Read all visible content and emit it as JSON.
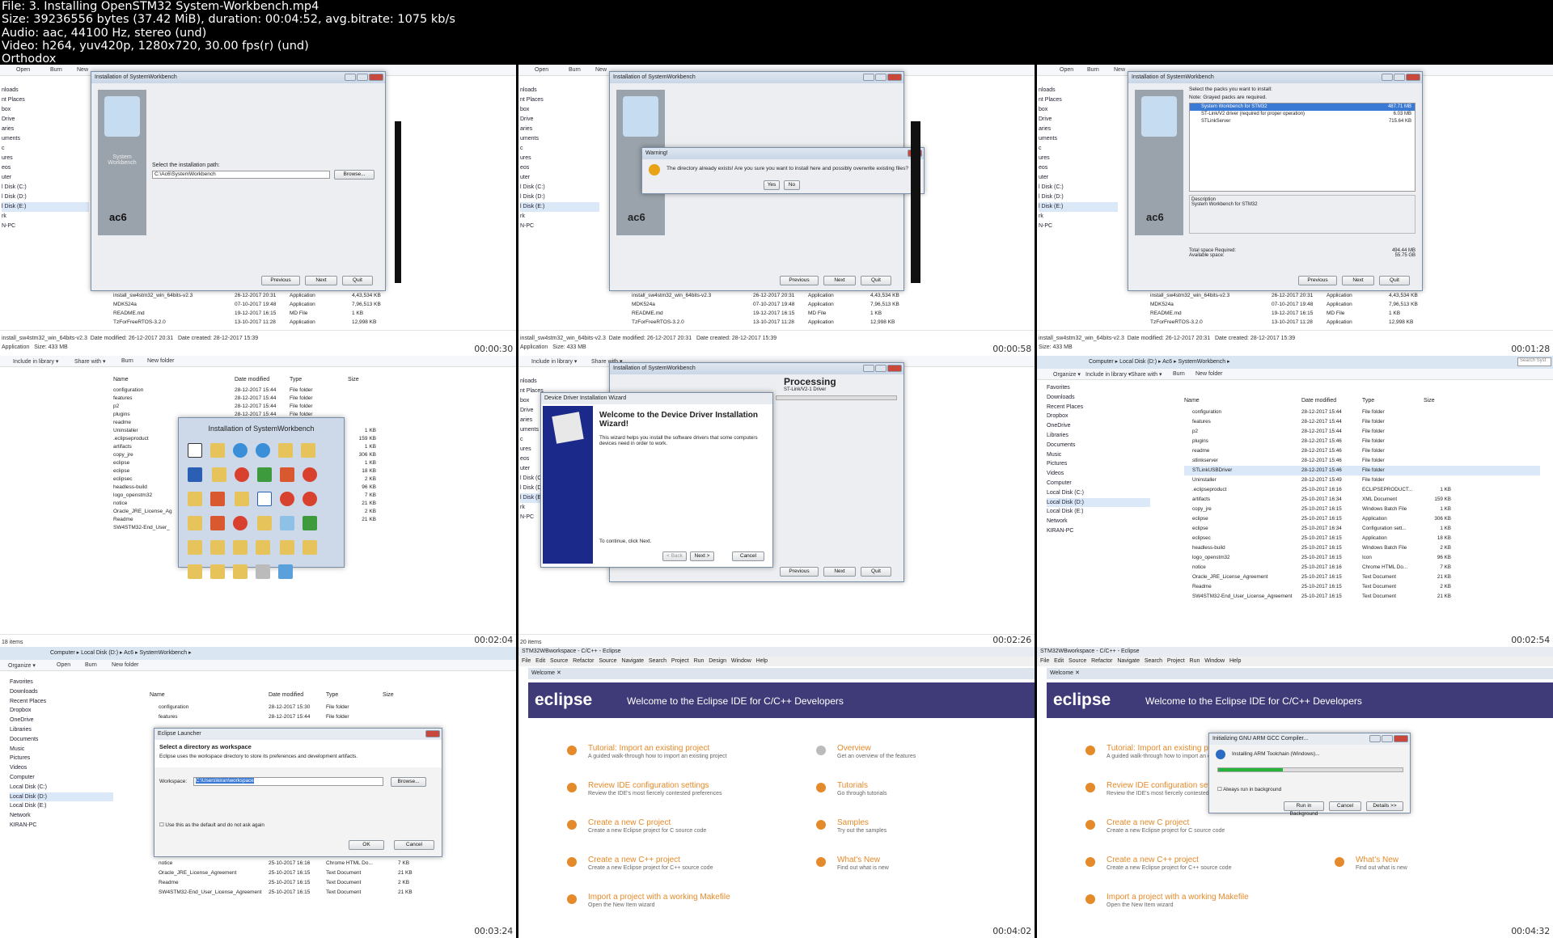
{
  "header": {
    "line1": "File: 3. Installing OpenSTM32  System-Workbench.mp4",
    "line2": "Size: 39236556 bytes (37.42 MiB), duration: 00:04:52, avg.bitrate: 1075 kb/s",
    "line3": "Audio: aac, 44100 Hz, stereo (und)",
    "line4": "Video: h264, yuv420p, 1280x720, 30.00 fps(r) (und)",
    "line5": "Orthodox"
  },
  "timestamps": [
    "00:00:30",
    "00:00:58",
    "00:01:28",
    "00:02:04",
    "00:02:26",
    "00:02:54",
    "00:03:24",
    "00:04:02",
    "00:04:32"
  ],
  "explorer": {
    "open": "Open",
    "burn": "Burn",
    "new": "New",
    "include": "Include in library ▾",
    "share": "Share with ▾",
    "newfolder": "New folder",
    "organize": "Organize ▾",
    "nav": [
      "nloads",
      "nt Places",
      "box",
      "Drive",
      "aries",
      "uments",
      "c",
      "ures",
      "eos",
      "uter",
      "l Disk (C:)",
      "l Disk (D:)",
      "l Disk (E:)",
      "rk",
      "N-PC"
    ],
    "files": [
      {
        "name": "install_sw4stm32_win_64bits-v2.3",
        "date": "26-12-2017 20:31",
        "type": "Application",
        "size": "4,43,534 KB"
      },
      {
        "name": "MDK524a",
        "date": "07-10-2017 19:48",
        "type": "Application",
        "size": "7,96,513 KB"
      },
      {
        "name": "README.md",
        "date": "19-12-2017 16:15",
        "type": "MD File",
        "size": "1 KB"
      },
      {
        "name": "TzForFreeRTOS-3.2.0",
        "date": "13-10-2017 11:28",
        "type": "Application",
        "size": "12,998 KB"
      }
    ],
    "status_name": "install_sw4stm32_win_64bits-v2.3",
    "status_modified": "Date modified: 26-12-2017 20:31",
    "status_created": "Date created: 28-12-2017 15:39",
    "status_type": "Application",
    "status_size": "Size: 433 MB",
    "col_name": "Name",
    "col_date": "Date modified",
    "col_type": "Type",
    "col_size": "Size"
  },
  "installer": {
    "title": "Installation of SystemWorkbench",
    "logo_text": "System Workbench",
    "ac6": "ac6",
    "path_label": "Select the installation path:",
    "path_value": "C:\\Ac6\\SystemWorkbench",
    "browse": "Browse...",
    "previous": "Previous",
    "next": "Next",
    "quit": "Quit"
  },
  "warning": {
    "title": "Warning!",
    "message": "The directory already exists! Are you sure you want to install here and possibly overwrite existing files?",
    "yes": "Yes",
    "no": "No"
  },
  "packs": {
    "select": "Select the packs you want to install:",
    "note": "Note: Grayed packs are required.",
    "items": [
      {
        "name": "System Workbench for STM32",
        "size": "487.71 MB"
      },
      {
        "name": "ST-Link/V2 driver (required for proper operation)",
        "size": "6.03 MB"
      },
      {
        "name": "STLinkServer",
        "size": "715.64 KB"
      }
    ],
    "desc_label": "Description",
    "desc": "System Workbench for STM32",
    "space_req": "Total space Required:",
    "space_req_val": "494.44 MB",
    "avail": "Available space:",
    "avail_val": "55.75 GB"
  },
  "folder": {
    "items": [
      {
        "name": "configuration",
        "date": "28-12-2017 15:44",
        "type": "File folder"
      },
      {
        "name": "features",
        "date": "28-12-2017 15:44",
        "type": "File folder"
      },
      {
        "name": "p2",
        "date": "28-12-2017 15:44",
        "type": "File folder"
      },
      {
        "name": "plugins",
        "date": "28-12-2017 15:44",
        "type": "File folder"
      },
      {
        "name": "readme",
        "date": "",
        "type": ""
      },
      {
        "name": "Uninstaller",
        "date": "",
        "type": ""
      },
      {
        "name": ".eclipseproduct",
        "date": "",
        "type": ""
      },
      {
        "name": "artifacts",
        "date": "",
        "type": ""
      },
      {
        "name": "copy_jre",
        "date": "",
        "type": ""
      },
      {
        "name": "eclipse",
        "date": "",
        "type": ""
      },
      {
        "name": "eclipse",
        "date": "",
        "type": ""
      },
      {
        "name": "eclipsec",
        "date": "",
        "type": ""
      },
      {
        "name": "headless-build",
        "date": "",
        "type": ""
      },
      {
        "name": "logo_openstm32",
        "date": "",
        "type": ""
      },
      {
        "name": "notice",
        "date": "",
        "type": ""
      },
      {
        "name": "Oracle_JRE_License_Ag",
        "date": "",
        "type": ""
      },
      {
        "name": "Readme",
        "date": "",
        "type": ""
      },
      {
        "name": "SW4STM32-End_User_",
        "date": "",
        "type": ""
      }
    ],
    "sizes": [
      "1 KB",
      "159 KB",
      "1 KB",
      "306 KB",
      "1 KB",
      "18 KB",
      "2 KB",
      "96 KB",
      "7 KB",
      "21 KB",
      "2 KB",
      "21 KB"
    ],
    "count": "18 items",
    "install_overlay": "Installation of SystemWorkbench"
  },
  "driver": {
    "title": "Device Driver Installation Wizard",
    "heading": "Welcome to the Device Driver Installation Wizard!",
    "body": "This wizard helps you install the software drivers that some computers devices need in order to work.",
    "cont": "To continue, click Next.",
    "back": "< Back",
    "next": "Next >",
    "cancel": "Cancel",
    "processing": "Processing",
    "proc_sub": "ST-Link/V2-1 Driver",
    "count": "20 items"
  },
  "explorer6": {
    "path": [
      "Computer",
      "Local Disk (D:)",
      "Ac6",
      "SystemWorkbench"
    ],
    "search": "Search Syst",
    "nav": [
      "Favorites",
      "Downloads",
      "Recent Places",
      "Dropbox",
      "OneDrive",
      "Libraries",
      "Documents",
      "Music",
      "Pictures",
      "Videos",
      "Computer",
      "Local Disk (C:)",
      "Local Disk (D:)",
      "Local Disk (E:)",
      "Network",
      "KIRAN-PC"
    ],
    "files": [
      {
        "name": "configuration",
        "date": "28-12-2017 15:44",
        "type": "File folder",
        "size": ""
      },
      {
        "name": "features",
        "date": "28-12-2017 15:44",
        "type": "File folder",
        "size": ""
      },
      {
        "name": "p2",
        "date": "28-12-2017 15:44",
        "type": "File folder",
        "size": ""
      },
      {
        "name": "plugins",
        "date": "28-12-2017 15:46",
        "type": "File folder",
        "size": ""
      },
      {
        "name": "readme",
        "date": "28-12-2017 15:46",
        "type": "File folder",
        "size": ""
      },
      {
        "name": "stlinkserver",
        "date": "28-12-2017 15:46",
        "type": "File folder",
        "size": ""
      },
      {
        "name": "STLinkUSBDriver",
        "date": "28-12-2017 15:46",
        "type": "File folder",
        "size": ""
      },
      {
        "name": "Uninstaller",
        "date": "28-12-2017 15:49",
        "type": "File folder",
        "size": ""
      },
      {
        "name": ".eclipseproduct",
        "date": "25-10-2017 16:16",
        "type": "ECLIPSEPRODUCT...",
        "size": "1 KB"
      },
      {
        "name": "artifacts",
        "date": "25-10-2017 16:34",
        "type": "XML Document",
        "size": "159 KB"
      },
      {
        "name": "copy_jre",
        "date": "25-10-2017 16:15",
        "type": "Windows Batch File",
        "size": "1 KB"
      },
      {
        "name": "eclipse",
        "date": "25-10-2017 16:15",
        "type": "Application",
        "size": "306 KB"
      },
      {
        "name": "eclipse",
        "date": "25-10-2017 16:34",
        "type": "Configuration sett...",
        "size": "1 KB"
      },
      {
        "name": "eclipsec",
        "date": "25-10-2017 16:15",
        "type": "Application",
        "size": "18 KB"
      },
      {
        "name": "headless-build",
        "date": "25-10-2017 16:15",
        "type": "Windows Batch File",
        "size": "2 KB"
      },
      {
        "name": "logo_openstm32",
        "date": "25-10-2017 16:15",
        "type": "Icon",
        "size": "96 KB"
      },
      {
        "name": "notice",
        "date": "25-10-2017 16:16",
        "type": "Chrome HTML Do...",
        "size": "7 KB"
      },
      {
        "name": "Oracle_JRE_License_Agreement",
        "date": "25-10-2017 16:15",
        "type": "Text Document",
        "size": "21 KB"
      },
      {
        "name": "Readme",
        "date": "25-10-2017 16:15",
        "type": "Text Document",
        "size": "2 KB"
      },
      {
        "name": "SW4STM32-End_User_License_Agreement",
        "date": "25-10-2017 16:15",
        "type": "Text Document",
        "size": "21 KB"
      }
    ]
  },
  "launcher": {
    "title": "Eclipse Launcher",
    "heading": "Select a directory as workspace",
    "desc": "Eclipse uses the workspace directory to store its preferences and development artifacts.",
    "ws_label": "Workspace:",
    "ws_value": "C:\\Users\\kiran\\workspace",
    "browse": "Browse...",
    "default": "Use this as the default and do not ask again",
    "ok": "OK",
    "cancel": "Cancel",
    "files": [
      {
        "name": "configuration",
        "date": "28-12-2017 15:30",
        "type": "File folder"
      },
      {
        "name": "features",
        "date": "28-12-2017 15:44",
        "type": "File folder"
      },
      {
        "name": "notice",
        "date": "25-10-2017 16:16",
        "type": "Chrome HTML Do...",
        "size": "7 KB"
      },
      {
        "name": "Oracle_JRE_License_Agreement",
        "date": "25-10-2017 16:15",
        "type": "Text Document",
        "size": "21 KB"
      },
      {
        "name": "Readme",
        "date": "25-10-2017 16:15",
        "type": "Text Document",
        "size": "2 KB"
      },
      {
        "name": "SW4STM32-End_User_License_Agreement",
        "date": "25-10-2017 16:15",
        "type": "Text Document",
        "size": "21 KB"
      }
    ]
  },
  "eclipse": {
    "title": "STM32WBworkspace - C/C++ - Eclipse",
    "menu": [
      "File",
      "Edit",
      "Source",
      "Refactor",
      "Source",
      "Navigate",
      "Search",
      "Project",
      "Run",
      "Design",
      "Window",
      "Help"
    ],
    "tab": "Welcome",
    "logo": "eclipse",
    "welcome": "Welcome to the Eclipse IDE for C/C++ Developers",
    "left": [
      {
        "t": "Tutorial: Import an existing project",
        "d": "A guided walk-through how to import an existing project"
      },
      {
        "t": "Review IDE configuration settings",
        "d": "Review the IDE's most fiercely contested preferences"
      },
      {
        "t": "Create a new C project",
        "d": "Create a new Eclipse project for C source code"
      },
      {
        "t": "Create a new C++ project",
        "d": "Create a new Eclipse project for C++ source code"
      },
      {
        "t": "Import a project with a working Makefile",
        "d": "Open the New Item wizard"
      }
    ],
    "right": [
      {
        "t": "Overview",
        "d": "Get an overview of the features"
      },
      {
        "t": "Tutorials",
        "d": "Go through tutorials"
      },
      {
        "t": "Samples",
        "d": "Try out the samples"
      },
      {
        "t": "What's New",
        "d": "Find out what is new"
      }
    ]
  },
  "gcc": {
    "title": "Initializing GNU ARM GCC Compiler...",
    "msg": "Installing ARM Toolchain (Windows)...",
    "always": "Always run in background",
    "run_bg": "Run in Background",
    "cancel": "Cancel",
    "details": "Details >>",
    "progress": 0.35
  }
}
